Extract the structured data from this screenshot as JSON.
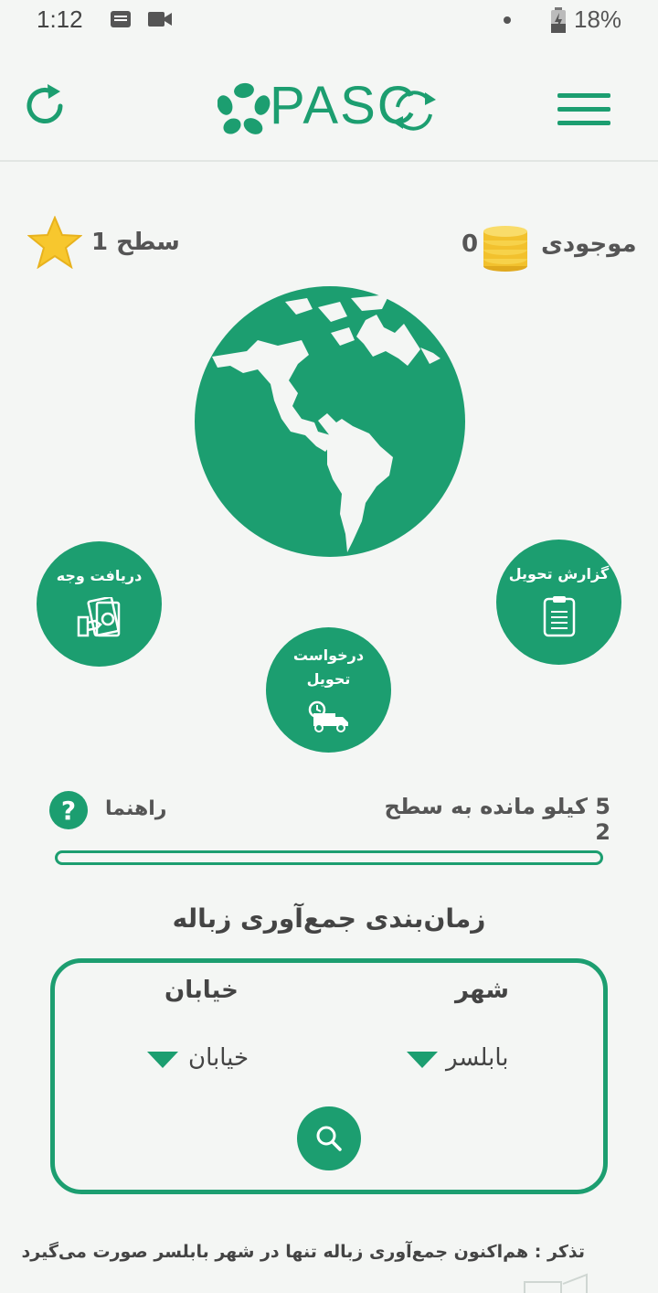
{
  "status_bar": {
    "time": "1:12",
    "battery": "18%"
  },
  "header": {
    "logo_text": "PASC",
    "refresh_icon": "refresh-icon",
    "menu_icon": "hamburger-menu-icon"
  },
  "stats": {
    "level_label": "سطح 1",
    "balance_label": "موجودی",
    "balance_value": "0"
  },
  "actions": {
    "withdraw_label": "دریافت وجه",
    "request_label_line1": "درخواست",
    "request_label_line2": "تحویل",
    "report_label": "گزارش تحویل"
  },
  "progress": {
    "remaining_text": "5 کیلو مانده به سطح 2",
    "help_label": "راهنما",
    "fill_fraction": 0
  },
  "schedule": {
    "title": "زمان‌بندی جمع‌آوری زباله",
    "city_header": "شهر",
    "city_value": "بابلسر",
    "street_header": "خیابان",
    "street_value": "خیابان"
  },
  "note": "تذکر : هم‌اکنون جمع‌آوری زباله تنها در شهر بابلسر صورت می‌گیرد",
  "colors": {
    "accent": "#1c9e70",
    "background": "#f4f6f4",
    "coin": "#f2c12e"
  }
}
